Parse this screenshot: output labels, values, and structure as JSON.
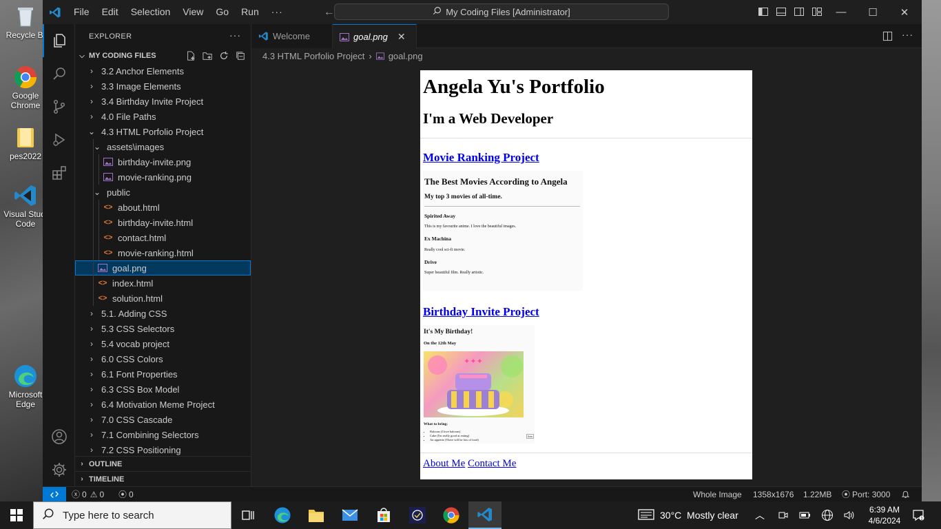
{
  "desktop": {
    "icons": [
      {
        "label": "Recycle Bi",
        "name": "recycle-bin"
      },
      {
        "label": "Google Chrome",
        "name": "chrome"
      },
      {
        "label": "pes2022",
        "name": "folder"
      },
      {
        "label": "Visual Studi Code",
        "name": "vscode"
      },
      {
        "label": "Microsoft Edge",
        "name": "edge"
      }
    ]
  },
  "titlebar": {
    "menu": [
      "File",
      "Edit",
      "Selection",
      "View",
      "Go",
      "Run"
    ],
    "more": "···",
    "command_center": "My Coding Files [Administrator]"
  },
  "sidebar": {
    "title": "EXPLORER",
    "more": "···",
    "folder": "MY CODING FILES",
    "items": [
      {
        "label": "3.2 Anchor Elements",
        "type": "folder",
        "depth": 1,
        "open": false
      },
      {
        "label": "3.3 Image Elements",
        "type": "folder",
        "depth": 1,
        "open": false
      },
      {
        "label": "3.4 Birthday Invite Project",
        "type": "folder",
        "depth": 1,
        "open": false
      },
      {
        "label": "4.0 File Paths",
        "type": "folder",
        "depth": 1,
        "open": false
      },
      {
        "label": "4.3 HTML Porfolio Project",
        "type": "folder",
        "depth": 1,
        "open": true
      },
      {
        "label": "assets\\images",
        "type": "folder",
        "depth": 2,
        "open": true
      },
      {
        "label": "birthday-invite.png",
        "type": "png",
        "depth": 3
      },
      {
        "label": "movie-ranking.png",
        "type": "png",
        "depth": 3
      },
      {
        "label": "public",
        "type": "folder",
        "depth": 2,
        "open": true
      },
      {
        "label": "about.html",
        "type": "html",
        "depth": 3
      },
      {
        "label": "birthday-invite.html",
        "type": "html",
        "depth": 3
      },
      {
        "label": "contact.html",
        "type": "html",
        "depth": 3
      },
      {
        "label": "movie-ranking.html",
        "type": "html",
        "depth": 3
      },
      {
        "label": "goal.png",
        "type": "png",
        "depth": 2,
        "selected": true
      },
      {
        "label": "index.html",
        "type": "html",
        "depth": 2
      },
      {
        "label": "solution.html",
        "type": "html",
        "depth": 2
      },
      {
        "label": "5.1. Adding CSS",
        "type": "folder",
        "depth": 1,
        "open": false
      },
      {
        "label": "5.3 CSS Selectors",
        "type": "folder",
        "depth": 1,
        "open": false
      },
      {
        "label": "5.4 vocab project",
        "type": "folder",
        "depth": 1,
        "open": false
      },
      {
        "label": "6.0 CSS Colors",
        "type": "folder",
        "depth": 1,
        "open": false
      },
      {
        "label": "6.1 Font Properties",
        "type": "folder",
        "depth": 1,
        "open": false
      },
      {
        "label": "6.3 CSS Box Model",
        "type": "folder",
        "depth": 1,
        "open": false
      },
      {
        "label": "6.4 Motivation Meme Project",
        "type": "folder",
        "depth": 1,
        "open": false
      },
      {
        "label": "7.0 CSS Cascade",
        "type": "folder",
        "depth": 1,
        "open": false
      },
      {
        "label": "7.1 Combining Selectors",
        "type": "folder",
        "depth": 1,
        "open": false
      },
      {
        "label": "7.2 CSS Positioning",
        "type": "folder",
        "depth": 1,
        "open": false
      }
    ],
    "outline": "OUTLINE",
    "timeline": "TIMELINE"
  },
  "tabs": [
    {
      "label": "Welcome",
      "active": false
    },
    {
      "label": "goal.png",
      "active": true
    }
  ],
  "breadcrumb": [
    "4.3 HTML Porfolio Project",
    "goal.png"
  ],
  "preview": {
    "h1": "Angela Yu's Portfolio",
    "h2": "I'm a Web Developer",
    "movie_link": "Movie Ranking Project",
    "movie": {
      "title": "The Best Movies According to Angela",
      "subtitle": "My top 3 movies of all-time.",
      "items": [
        {
          "name": "Spirited Away",
          "desc": "This is my favourite anime. I love the beautiful images."
        },
        {
          "name": "Ex Machina",
          "desc": "Really cool sci-fi movie."
        },
        {
          "name": "Drive",
          "desc": "Super beautiful film. Really artistic."
        }
      ]
    },
    "birthday_link": "Birthday Invite Project",
    "birthday": {
      "title": "It's My Birthday!",
      "date": "On the 12th May",
      "bring_title": "What to bring:",
      "bring": [
        "Baloons (I love baloons)",
        "Cake (I'm really good at eating)",
        "An appetite (There will be lots of food)"
      ],
      "join": "Join"
    },
    "footer_links": [
      "About Me",
      "Contact Me"
    ]
  },
  "statusbar": {
    "errors": "0",
    "warnings": "0",
    "ports": "0",
    "whole_image": "Whole Image",
    "dimensions": "1358x1676",
    "size": "1.22MB",
    "port": "Port: 3000"
  },
  "taskbar": {
    "search_placeholder": "Type here to search",
    "weather": "30°C  Mostly clear",
    "time": "6:39 AM",
    "date": "4/6/2024"
  },
  "colors": {
    "accent": "#0078d4",
    "html_icon": "#e37933",
    "png_icon": "#a074c4"
  }
}
